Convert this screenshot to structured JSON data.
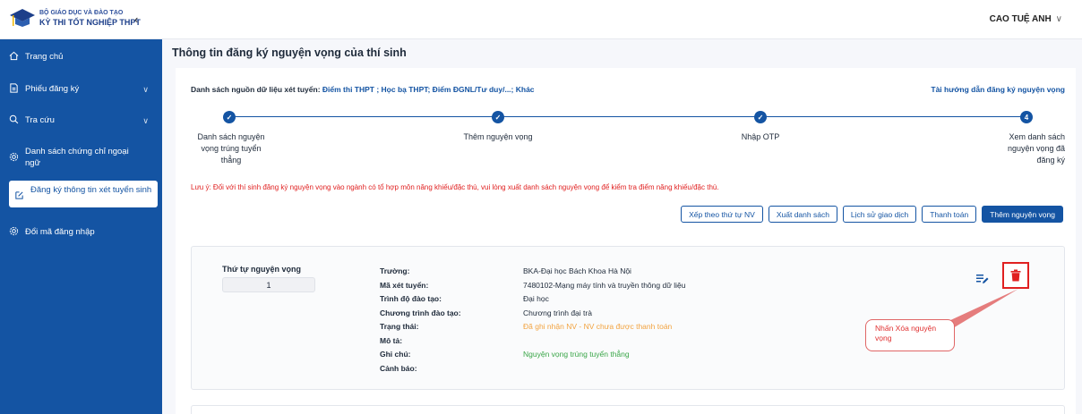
{
  "header": {
    "logo_line1": "BỘ GIÁO DỤC VÀ ĐÀO TẠO",
    "logo_line2": "KỲ THI TỐT NGHIỆP THPT",
    "collapse_glyph": "‹",
    "user_name": "CAO TUỆ ANH",
    "user_chevron": "∨"
  },
  "sidebar": {
    "items": [
      {
        "label": "Trang chủ",
        "icon": "home-icon"
      },
      {
        "label": "Phiếu đăng ký",
        "icon": "document-icon",
        "chevron": "∨"
      },
      {
        "label": "Tra cứu",
        "icon": "search-icon",
        "chevron": "∨"
      },
      {
        "label": "Danh sách chứng chỉ ngoại ngữ",
        "icon": "gear-icon"
      },
      {
        "label": "Đăng ký thông tin xét tuyển sinh",
        "icon": "edit-icon"
      },
      {
        "label": "Đổi mã đăng nhập",
        "icon": "gear-icon"
      }
    ]
  },
  "main": {
    "title": "Thông tin đăng ký nguyện vọng của thí sinh",
    "sources_label": "Danh sách nguồn dữ liệu xét tuyển:",
    "sources_links": "Điểm thi THPT ; Học bạ THPT; Điểm ĐGNL/Tư duy/...; Khác",
    "guide_link": "Tài hướng dẫn đăng ký nguyện vọng",
    "steps": [
      {
        "label1": "Danh sách nguyện",
        "label2": "vọng trúng tuyển",
        "label3": "thẳng",
        "mark": "✓"
      },
      {
        "label1": "Thêm nguyện vọng",
        "mark": "✓"
      },
      {
        "label1": "Nhập OTP",
        "mark": "✓"
      },
      {
        "label1": "Xem danh sách",
        "label2": "nguyện vọng đã",
        "label3": "đăng ký",
        "mark": "4"
      }
    ],
    "note": "Lưu ý: Đối với thí sinh đăng ký nguyện vọng vào ngành có tổ hợp môn năng khiếu/đặc thù, vui lòng xuất danh sách nguyện vọng để kiểm tra điểm năng khiếu/đặc thù.",
    "buttons": {
      "sort": "Xếp theo thứ tự NV",
      "export": "Xuất danh sách",
      "history": "Lịch sử giao dịch",
      "pay": "Thanh toán",
      "add": "Thêm nguyện vọng"
    },
    "card": {
      "order_label": "Thứ tự nguyện vọng",
      "order_value": "1",
      "fields": {
        "school_label": "Trường:",
        "school_value": "BKA-Đại học Bách Khoa Hà Nội",
        "code_label": "Mã xét tuyển:",
        "code_value": "7480102-Mạng máy tính và truyền thông dữ liệu",
        "level_label": "Trình độ đào tạo:",
        "level_value": "Đại học",
        "program_label": "Chương trình đào tạo:",
        "program_value": "Chương trình đại trà",
        "status_label": "Trạng thái:",
        "status_value": "Đã ghi nhận NV - NV chưa được thanh toán",
        "desc_label": "Mô tả:",
        "desc_value": "",
        "remark_label": "Ghi chú:",
        "remark_value": "Nguyện vọng trúng tuyển thẳng",
        "warning_label": "Cảnh báo:",
        "warning_value": ""
      },
      "callout": "Nhấn Xóa nguyện vọng"
    }
  },
  "colors": {
    "primary": "#1454a3",
    "danger": "#e02020",
    "status_orange": "#f2a340",
    "status_green": "#3aa648"
  }
}
